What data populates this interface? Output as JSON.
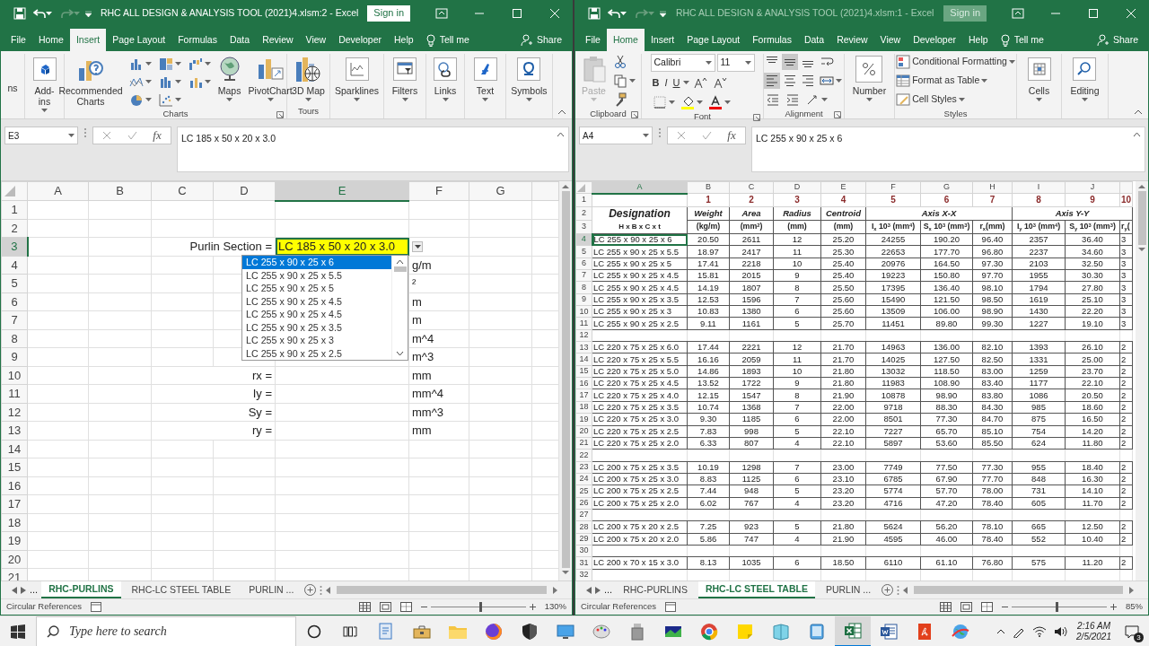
{
  "windows": [
    {
      "title": "RHC ALL DESIGN & ANALYSIS TOOL (2021)4.xlsm:2 - Excel",
      "active": true,
      "sign_in": "Sign in",
      "tabs": [
        {
          "label": "File",
          "selected": false
        },
        {
          "label": "Home",
          "selected": false
        },
        {
          "label": "Insert",
          "selected": true
        },
        {
          "label": "Page Layout",
          "selected": false
        },
        {
          "label": "Formulas",
          "selected": false
        },
        {
          "label": "Data",
          "selected": false
        },
        {
          "label": "Review",
          "selected": false
        },
        {
          "label": "View",
          "selected": false
        },
        {
          "label": "Developer",
          "selected": false
        },
        {
          "label": "Help",
          "selected": false
        }
      ],
      "tell_me": "Tell me",
      "share": "Share",
      "ribbon": {
        "kind": "insert",
        "groups": [
          {
            "buttons": [
              {
                "label": "ns",
                "disabled": false
              }
            ]
          },
          {
            "buttons": [
              {
                "label": "Add-ins",
                "disabled": false
              }
            ]
          },
          {
            "label": "Charts",
            "buttons": [
              {
                "label": "Recommended Charts",
                "disabled": false
              },
              {
                "label": "Maps",
                "disabled": false
              },
              {
                "label": "PivotChart",
                "disabled": false
              }
            ]
          },
          {
            "label": "Tours",
            "buttons": [
              {
                "label": "3D Map",
                "disabled": false
              }
            ]
          },
          {
            "buttons": [
              {
                "label": "Sparklines",
                "disabled": false
              }
            ]
          },
          {
            "buttons": [
              {
                "label": "Filters",
                "disabled": false
              }
            ]
          },
          {
            "buttons": [
              {
                "label": "Links",
                "disabled": false
              }
            ]
          },
          {
            "buttons": [
              {
                "label": "Text",
                "disabled": false
              }
            ]
          },
          {
            "buttons": [
              {
                "label": "Symbols",
                "disabled": false
              }
            ]
          }
        ]
      },
      "name_box": "E3",
      "fx": "fx",
      "formula": "LC 185 x 50 x 20 x 3.0",
      "sheet": {
        "kind": "form",
        "columns": [
          {
            "label": "A",
            "selected": false
          },
          {
            "label": "B",
            "selected": false
          },
          {
            "label": "C",
            "selected": false
          },
          {
            "label": "D",
            "selected": false
          },
          {
            "label": "E",
            "selected": true
          },
          {
            "label": "F",
            "selected": false
          },
          {
            "label": "G",
            "selected": false
          }
        ],
        "rows": [
          {
            "number": "1",
            "selected": false
          },
          {
            "number": "2",
            "selected": false
          },
          {
            "number": "3",
            "selected": true,
            "label": "Purlin Section =",
            "value": "LC 185 x 50 x 20 x 3.0"
          },
          {
            "number": "4",
            "selected": false,
            "unit": "g/m"
          },
          {
            "number": "5",
            "selected": false,
            "unit": "²"
          },
          {
            "number": "6",
            "selected": false,
            "unit": "m"
          },
          {
            "number": "7",
            "selected": false,
            "unit": "m"
          },
          {
            "number": "8",
            "selected": false,
            "unit": "m^4"
          },
          {
            "number": "9",
            "selected": false,
            "unit": "m^3"
          },
          {
            "number": "10",
            "selected": false,
            "label": "rx =",
            "unit": "mm"
          },
          {
            "number": "11",
            "selected": false,
            "label": "Iy =",
            "unit": "mm^4"
          },
          {
            "number": "12",
            "selected": false,
            "label": "Sy =",
            "unit": "mm^3"
          },
          {
            "number": "13",
            "selected": false,
            "label": "ry =",
            "unit": "mm"
          },
          {
            "number": "14",
            "selected": false
          },
          {
            "number": "15",
            "selected": false
          },
          {
            "number": "16",
            "selected": false
          },
          {
            "number": "17",
            "selected": false
          },
          {
            "number": "18",
            "selected": false
          },
          {
            "number": "19",
            "selected": false
          },
          {
            "number": "20",
            "selected": false
          },
          {
            "number": "21",
            "selected": false
          }
        ],
        "dropdown": {
          "items": [
            {
              "text": "LC 255 x 90 x 25 x 6",
              "selected": true
            },
            {
              "text": "LC 255 x 90 x 25 x 5.5",
              "selected": false
            },
            {
              "text": "LC 255 x 90 x 25 x 5",
              "selected": false
            },
            {
              "text": "LC 255 x 90 x 25 x 4.5",
              "selected": false
            },
            {
              "text": "LC 255 x 90 x 25 x 4.5",
              "selected": false
            },
            {
              "text": "LC 255 x 90 x 25 x 3.5",
              "selected": false
            },
            {
              "text": "LC 255 x 90 x 25 x 3",
              "selected": false
            },
            {
              "text": "LC 255 x 90 x 25 x 2.5",
              "selected": false
            }
          ]
        }
      },
      "tabs_more": "...",
      "sheet_tabs": [
        {
          "label": "RHC-PURLINS",
          "selected": true
        },
        {
          "label": "RHC-LC STEEL TABLE",
          "selected": false
        },
        {
          "label": "PURLIN ...",
          "selected": false
        }
      ],
      "status": "Circular References",
      "zoom": "130%",
      "zoom_slider": {
        "level": 0.52
      }
    },
    {
      "title": "RHC ALL DESIGN & ANALYSIS TOOL (2021)4.xlsm:1 - Excel",
      "active": false,
      "sign_in": "Sign in",
      "tabs": [
        {
          "label": "File",
          "selected": false
        },
        {
          "label": "Home",
          "selected": true
        },
        {
          "label": "Insert",
          "selected": false
        },
        {
          "label": "Page Layout",
          "selected": false
        },
        {
          "label": "Formulas",
          "selected": false
        },
        {
          "label": "Data",
          "selected": false
        },
        {
          "label": "Review",
          "selected": false
        },
        {
          "label": "View",
          "selected": false
        },
        {
          "label": "Developer",
          "selected": false
        },
        {
          "label": "Help",
          "selected": false
        }
      ],
      "tell_me": "Tell me",
      "share": "Share",
      "ribbon": {
        "kind": "home",
        "groups": [
          {
            "label": "Clipboard",
            "buttons": [
              {
                "label": "Paste",
                "disabled": true
              }
            ]
          },
          {
            "label": "Font",
            "font": "Calibri",
            "size": "11",
            "styles": [
              "B",
              "I",
              "U"
            ]
          },
          {
            "label": "Alignment",
            "alignment": [
              {
                "selected": false
              },
              {
                "selected": true
              },
              {
                "selected": false
              },
              {
                "selected": true
              },
              {
                "selected": false
              },
              {
                "selected": false
              }
            ]
          },
          {
            "buttons": [
              {
                "label": "Number",
                "disabled": false
              }
            ]
          },
          {
            "label": "Styles",
            "buttons": [
              {
                "label": "Conditional Formatting",
                "disabled": false
              },
              {
                "label": "Format as Table",
                "disabled": false
              },
              {
                "label": "Cell Styles",
                "disabled": false
              }
            ]
          },
          {
            "buttons": [
              {
                "label": "Cells",
                "disabled": false
              }
            ]
          },
          {
            "buttons": [
              {
                "label": "Editing",
                "disabled": false
              }
            ]
          }
        ]
      },
      "name_box": "A4",
      "fx": "fx",
      "formula": "LC 255 x 90 x 25 x 6",
      "sheet": {
        "kind": "table",
        "columns": [
          {
            "label": "A",
            "selected": true
          },
          {
            "label": "B",
            "selected": false
          },
          {
            "label": "C",
            "selected": false
          },
          {
            "label": "D",
            "selected": false
          },
          {
            "label": "E",
            "selected": false
          },
          {
            "label": "F",
            "selected": false
          },
          {
            "label": "G",
            "selected": false
          },
          {
            "label": "H",
            "selected": false
          },
          {
            "label": "I",
            "selected": false
          },
          {
            "label": "J",
            "selected": false
          }
        ],
        "header_rows": [
          "1",
          "2",
          "3"
        ],
        "index_row": [
          "1",
          "2",
          "3",
          "4",
          "5",
          "6",
          "7",
          "8",
          "9",
          "10"
        ],
        "titles": [
          "Designation",
          "Weight",
          "Area",
          "Radius",
          "Centroid"
        ],
        "groups": [
          "Axis X-X",
          "Axis Y-Y"
        ],
        "units": [
          "H x B x C x t",
          "(kg/m)",
          "(mm$^{2}$)",
          "(mm)",
          "(mm)",
          "I$_{x}$ 10$^{3}$ (mm$^{4}$)",
          "S$_{x}$ 10$^{3}$ (mm$^{3}$)",
          "r$_{x}$(mm)",
          "I$_{y}$ 10$^{3}$ (mm$^{4}$)",
          "S$_{y}$ 10$^{3}$ (mm$^{3}$)",
          "r$_{y}$("
        ],
        "rows": [
          {
            "number": "4",
            "selected": true,
            "cells": [
              "LC 255 x 90 x 25 x 6",
              "20.50",
              "2611",
              "12",
              "25.20",
              "24255",
              "190.20",
              "96.40",
              "2357",
              "36.40",
              "3"
            ]
          },
          {
            "number": "5",
            "selected": false,
            "cells": [
              "LC 255 x 90 x 25 x 5.5",
              "18.97",
              "2417",
              "11",
              "25.30",
              "22653",
              "177.70",
              "96.80",
              "2237",
              "34.60",
              "3"
            ]
          },
          {
            "number": "6",
            "selected": false,
            "cells": [
              "LC 255 x 90 x 25 x 5",
              "17.41",
              "2218",
              "10",
              "25.40",
              "20976",
              "164.50",
              "97.30",
              "2103",
              "32.50",
              "3"
            ]
          },
          {
            "number": "7",
            "selected": false,
            "cells": [
              "LC 255 x 90 x 25 x 4.5",
              "15.81",
              "2015",
              "9",
              "25.40",
              "19223",
              "150.80",
              "97.70",
              "1955",
              "30.30",
              "3"
            ]
          },
          {
            "number": "8",
            "selected": false,
            "cells": [
              "LC 255 x 90 x 25 x 4.5",
              "14.19",
              "1807",
              "8",
              "25.50",
              "17395",
              "136.40",
              "98.10",
              "1794",
              "27.80",
              "3"
            ]
          },
          {
            "number": "9",
            "selected": false,
            "cells": [
              "LC 255 x 90 x 25 x 3.5",
              "12.53",
              "1596",
              "7",
              "25.60",
              "15490",
              "121.50",
              "98.50",
              "1619",
              "25.10",
              "3"
            ]
          },
          {
            "number": "10",
            "selected": false,
            "cells": [
              "LC 255 x 90 x 25 x 3",
              "10.83",
              "1380",
              "6",
              "25.60",
              "13509",
              "106.00",
              "98.90",
              "1430",
              "22.20",
              "3"
            ]
          },
          {
            "number": "11",
            "selected": false,
            "cells": [
              "LC 255 x 90 x 25 x 2.5",
              "9.11",
              "1161",
              "5",
              "25.70",
              "11451",
              "89.80",
              "99.30",
              "1227",
              "19.10",
              "3"
            ]
          },
          {
            "number": "12",
            "selected": false
          },
          {
            "number": "13",
            "selected": false,
            "cells": [
              "LC 220 x 75 x 25 x 6.0",
              "17.44",
              "2221",
              "12",
              "21.70",
              "14963",
              "136.00",
              "82.10",
              "1393",
              "26.10",
              "2"
            ]
          },
          {
            "number": "14",
            "selected": false,
            "cells": [
              "LC 220 x 75 x 25 x 5.5",
              "16.16",
              "2059",
              "11",
              "21.70",
              "14025",
              "127.50",
              "82.50",
              "1331",
              "25.00",
              "2"
            ]
          },
          {
            "number": "15",
            "selected": false,
            "cells": [
              "LC 220 x 75 x 25 x 5.0",
              "14.86",
              "1893",
              "10",
              "21.80",
              "13032",
              "118.50",
              "83.00",
              "1259",
              "23.70",
              "2"
            ]
          },
          {
            "number": "16",
            "selected": false,
            "cells": [
              "LC 220 x 75 x 25 x 4.5",
              "13.52",
              "1722",
              "9",
              "21.80",
              "11983",
              "108.90",
              "83.40",
              "1177",
              "22.10",
              "2"
            ]
          },
          {
            "number": "17",
            "selected": false,
            "cells": [
              "LC 220 x 75 x 25 x 4.0",
              "12.15",
              "1547",
              "8",
              "21.90",
              "10878",
              "98.90",
              "83.80",
              "1086",
              "20.50",
              "2"
            ]
          },
          {
            "number": "18",
            "selected": false,
            "cells": [
              "LC 220 x 75 x 25 x 3.5",
              "10.74",
              "1368",
              "7",
              "22.00",
              "9718",
              "88.30",
              "84.30",
              "985",
              "18.60",
              "2"
            ]
          },
          {
            "number": "19",
            "selected": false,
            "cells": [
              "LC 220 x 75 x 25 x 3.0",
              "9.30",
              "1185",
              "6",
              "22.00",
              "8501",
              "77.30",
              "84.70",
              "875",
              "16.50",
              "2"
            ]
          },
          {
            "number": "20",
            "selected": false,
            "cells": [
              "LC 220 x 75 x 25 x 2.5",
              "7.83",
              "998",
              "5",
              "22.10",
              "7227",
              "65.70",
              "85.10",
              "754",
              "14.20",
              "2"
            ]
          },
          {
            "number": "21",
            "selected": false,
            "cells": [
              "LC 220 x 75 x 25 x 2.0",
              "6.33",
              "807",
              "4",
              "22.10",
              "5897",
              "53.60",
              "85.50",
              "624",
              "11.80",
              "2"
            ]
          },
          {
            "number": "22",
            "selected": false
          },
          {
            "number": "23",
            "selected": false,
            "cells": [
              "LC 200 x 75 x 25 x 3.5",
              "10.19",
              "1298",
              "7",
              "23.00",
              "7749",
              "77.50",
              "77.30",
              "955",
              "18.40",
              "2"
            ]
          },
          {
            "number": "24",
            "selected": false,
            "cells": [
              "LC 200 x 75 x 25 x 3.0",
              "8.83",
              "1125",
              "6",
              "23.10",
              "6785",
              "67.90",
              "77.70",
              "848",
              "16.30",
              "2"
            ]
          },
          {
            "number": "25",
            "selected": false,
            "cells": [
              "LC 200 x 75 x 25 x 2.5",
              "7.44",
              "948",
              "5",
              "23.20",
              "5774",
              "57.70",
              "78.00",
              "731",
              "14.10",
              "2"
            ]
          },
          {
            "number": "26",
            "selected": false,
            "cells": [
              "LC 200 x 75 x 25 x 2.0",
              "6.02",
              "767",
              "4",
              "23.20",
              "4716",
              "47.20",
              "78.40",
              "605",
              "11.70",
              "2"
            ]
          },
          {
            "number": "27",
            "selected": false
          },
          {
            "number": "28",
            "selected": false,
            "cells": [
              "LC 200 x 75 x 20 x 2.5",
              "7.25",
              "923",
              "5",
              "21.80",
              "5624",
              "56.20",
              "78.10",
              "665",
              "12.50",
              "2"
            ]
          },
          {
            "number": "29",
            "selected": false,
            "cells": [
              "LC 200 x 75 x 20 x 2.0",
              "5.86",
              "747",
              "4",
              "21.90",
              "4595",
              "46.00",
              "78.40",
              "552",
              "10.40",
              "2"
            ]
          },
          {
            "number": "30",
            "selected": false
          },
          {
            "number": "31",
            "selected": false,
            "cells": [
              "LC 200 x 70 x 15 x 3.0",
              "8.13",
              "1035",
              "6",
              "18.50",
              "6110",
              "61.10",
              "76.80",
              "575",
              "11.20",
              "2"
            ]
          },
          {
            "number": "32",
            "selected": false
          }
        ]
      },
      "tabs_more": "...",
      "sheet_tabs": [
        {
          "label": "RHC-PURLINS",
          "selected": false
        },
        {
          "label": "RHC-LC STEEL TABLE",
          "selected": true
        },
        {
          "label": "PURLIN ...",
          "selected": false
        }
      ],
      "status": "Circular References",
      "zoom": "85%",
      "zoom_slider": {
        "level": 0.47
      }
    }
  ],
  "taskbar": {
    "placeholder": "Type here to search",
    "apps": [
      {
        "kind": "document",
        "active": false
      },
      {
        "kind": "tools",
        "active": false
      },
      {
        "kind": "folder",
        "active": false
      },
      {
        "kind": "firefox",
        "active": false
      },
      {
        "kind": "shield",
        "active": false
      },
      {
        "kind": "monitor",
        "active": false
      },
      {
        "kind": "palette",
        "active": false
      },
      {
        "kind": "drive",
        "active": false
      },
      {
        "kind": "screen",
        "active": false
      },
      {
        "kind": "chrome",
        "active": false
      },
      {
        "kind": "note",
        "active": false
      },
      {
        "kind": "book",
        "active": false
      },
      {
        "kind": "tablet",
        "active": false
      },
      {
        "kind": "excel",
        "active": true
      },
      {
        "kind": "word",
        "active": false
      },
      {
        "kind": "pdf",
        "active": false
      },
      {
        "kind": "globe",
        "active": false
      }
    ],
    "time": "2:16 AM",
    "date": "2/5/2021",
    "notifications": "3"
  }
}
